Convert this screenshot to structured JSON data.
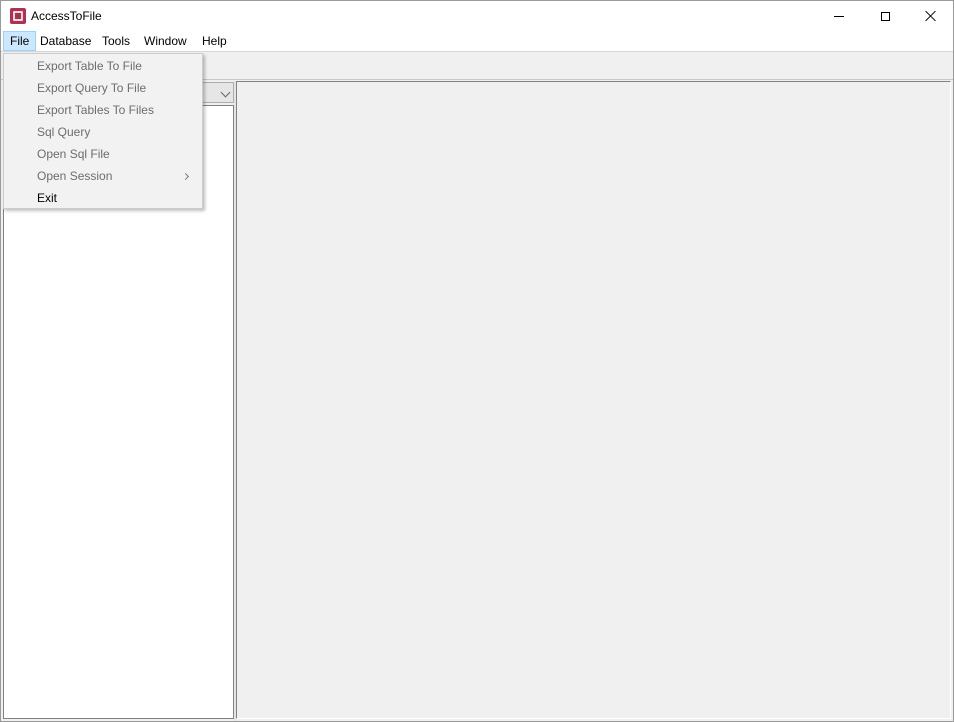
{
  "window": {
    "title": "AccessToFile"
  },
  "menubar": {
    "items": [
      {
        "label": "File",
        "active": true
      },
      {
        "label": "Database"
      },
      {
        "label": "Tools"
      },
      {
        "label": "Window"
      },
      {
        "label": "Help"
      }
    ]
  },
  "file_menu": {
    "items": [
      {
        "label": "Export Table To File",
        "enabled": false
      },
      {
        "label": "Export Query To File",
        "enabled": false
      },
      {
        "label": "Export Tables To Files",
        "enabled": false
      },
      {
        "label": "Sql Query",
        "enabled": false
      },
      {
        "label": "Open Sql File",
        "enabled": false
      },
      {
        "label": "Open Session",
        "enabled": false,
        "submenu": true
      },
      {
        "label": "Exit",
        "enabled": true
      }
    ]
  },
  "icons": {
    "app": "app-icon",
    "minimize": "minimize-icon",
    "maximize": "maximize-icon",
    "close": "close-icon",
    "submenu": "chevron-right-icon",
    "combo": "chevron-down-icon"
  },
  "colors": {
    "menu_active_bg": "#cce8ff",
    "menu_active_border": "#99d1ff",
    "app_icon": "#b0304f",
    "disabled_text": "#6d6d6d"
  }
}
